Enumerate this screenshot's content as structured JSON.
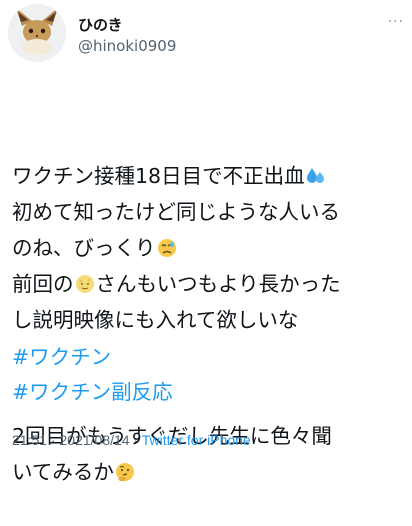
{
  "author": {
    "display_name": "ひのき",
    "handle": "@hinoki0909"
  },
  "more_menu": "...",
  "tweet": {
    "line1": "ワクチン接種18日目で不正出血",
    "line2": "初めて知ったけど同じような人いる",
    "line3": "のね、びっくり",
    "line4a": "前回の",
    "line4b": "さんもいつもより長かった",
    "line5": "し説明映像にも入れて欲しいな",
    "line6": "2回目がもうすぐだし先生に色々聞",
    "line7": "いてみるか",
    "hashtags": [
      "#ワクチン",
      "#ワクチン副反応"
    ]
  },
  "meta": {
    "time": "21:51",
    "sep": " · ",
    "date": "2021/08/14",
    "source": "Twitter for iPhone"
  },
  "icons": {
    "sweat_drops": "sweat-droplets-icon",
    "sad_face": "disappointed-relieved-face-icon",
    "moon_face": "full-moon-face-icon",
    "thinking_face": "thinking-face-icon"
  },
  "colors": {
    "link": "#1d9bf0",
    "secondary": "#536471",
    "text": "#0f1419"
  }
}
